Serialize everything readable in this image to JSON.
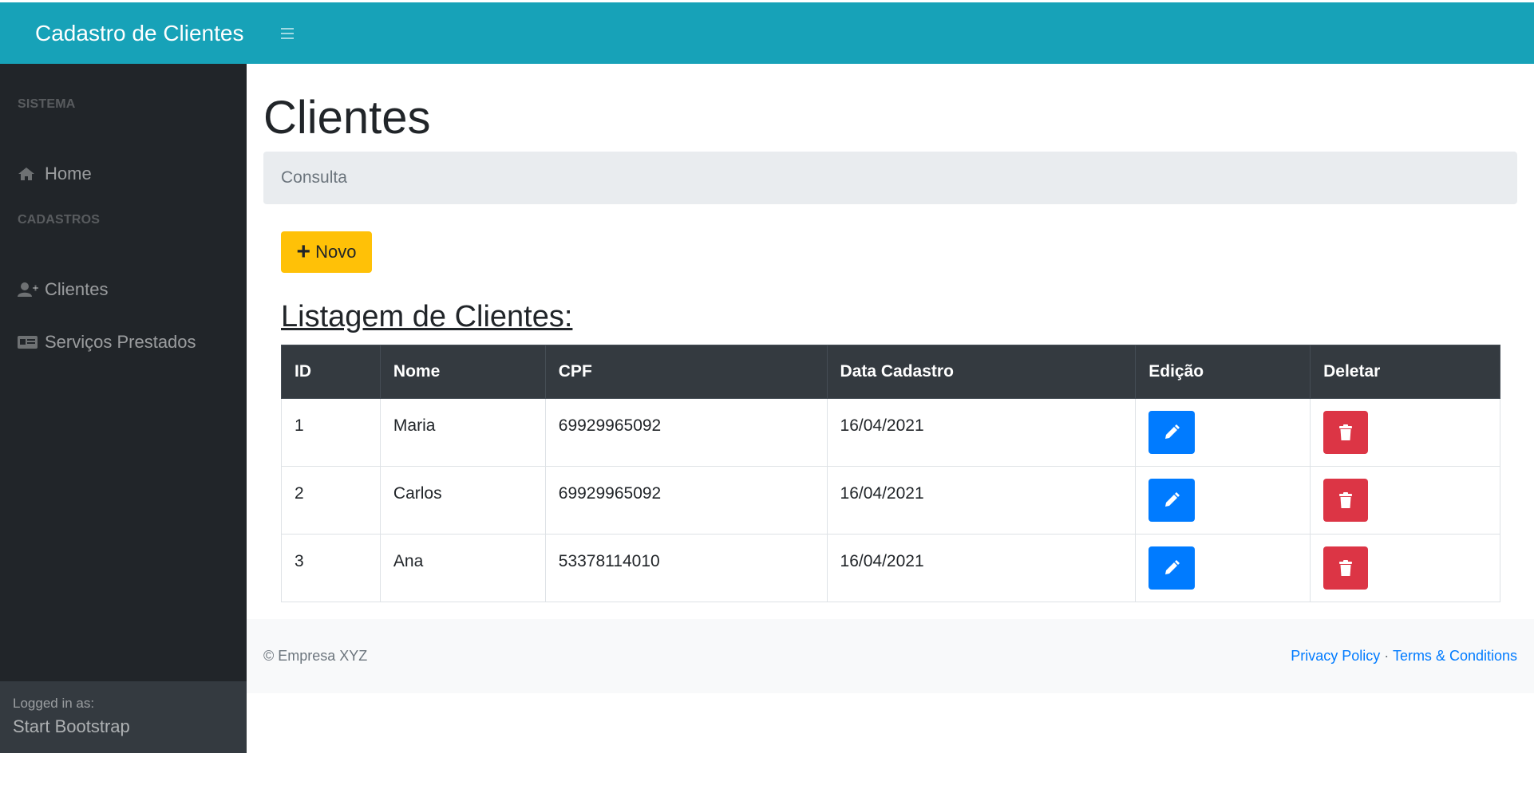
{
  "topbar": {
    "brand": "Cadastro de Clientes",
    "toggle_icon": "bars-icon"
  },
  "sidebar": {
    "sections": [
      {
        "heading": "SISTEMA",
        "items": [
          {
            "label": "Home",
            "icon": "home-icon"
          }
        ]
      },
      {
        "heading": "CADASTROS",
        "items": [
          {
            "label": "Clientes",
            "icon": "user-plus-icon"
          },
          {
            "label": "Serviços Prestados",
            "icon": "id-card-icon"
          }
        ]
      }
    ],
    "footer": {
      "logged_label": "Logged in as:",
      "user": "Start Bootstrap"
    }
  },
  "main": {
    "title": "Clientes",
    "breadcrumb": "Consulta",
    "new_button": {
      "icon": "plus-icon",
      "label": "Novo"
    },
    "list_title": "Listagem de Clientes:",
    "table": {
      "headers": [
        "ID",
        "Nome",
        "CPF",
        "Data Cadastro",
        "Edição",
        "Deletar"
      ],
      "rows": [
        {
          "id": "1",
          "nome": "Maria",
          "cpf": "69929965092",
          "data": "16/04/2021"
        },
        {
          "id": "2",
          "nome": "Carlos",
          "cpf": "69929965092",
          "data": "16/04/2021"
        },
        {
          "id": "3",
          "nome": "Ana",
          "cpf": "53378114010",
          "data": "16/04/2021"
        }
      ]
    }
  },
  "footer": {
    "copyright": "© Empresa XYZ",
    "privacy": "Privacy Policy",
    "separator": "·",
    "terms": "Terms & Conditions"
  },
  "colors": {
    "topbar": "#17a2b8",
    "sidebar": "#212529",
    "new_button": "#ffc107",
    "edit_button": "#007bff",
    "delete_button": "#dc3545",
    "table_header": "#343a40"
  }
}
